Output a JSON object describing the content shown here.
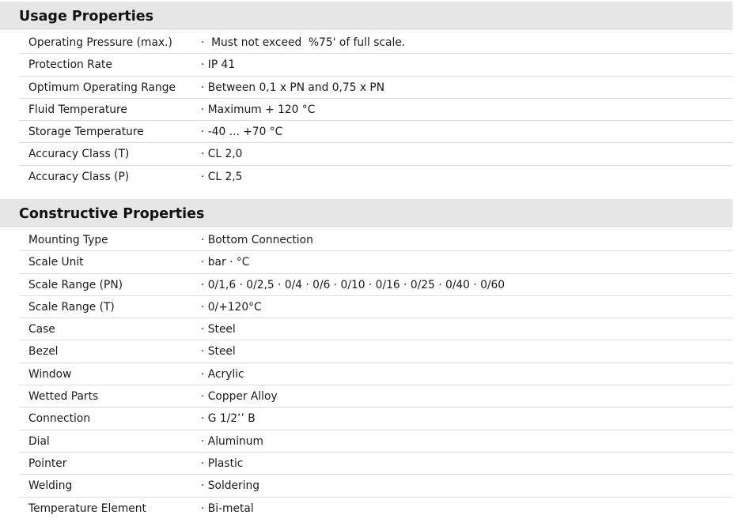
{
  "usage": {
    "title": "Usage Properties",
    "rows": [
      {
        "label": "Operating Pressure (max.)",
        "value": "·  Must not exceed  %75' of full scale."
      },
      {
        "label": "Protection Rate",
        "value": "· IP 41"
      },
      {
        "label": "Optimum Operating Range",
        "value": "· Between 0,1 x PN and 0,75 x PN"
      },
      {
        "label": "Fluid Temperature",
        "value": "· Maximum + 120 °C"
      },
      {
        "label": "Storage Temperature",
        "value": "· -40 ... +70 °C"
      },
      {
        "label": "Accuracy Class (T)",
        "value": "· CL 2,0"
      },
      {
        "label": "Accuracy Class (P)",
        "value": "· CL 2,5"
      }
    ]
  },
  "constructive": {
    "title": "Constructive Properties",
    "rows": [
      {
        "label": "Mounting Type",
        "value": "· Bottom Connection"
      },
      {
        "label": "Scale Unit",
        "value": "· bar · °C"
      },
      {
        "label": "Scale Range (PN)",
        "value": "· 0/1,6 · 0/2,5 · 0/4 · 0/6 · 0/10 · 0/16 · 0/25 · 0/40 · 0/60"
      },
      {
        "label": "Scale Range (T)",
        "value": "· 0/+120°C"
      },
      {
        "label": "Case",
        "value": "· Steel"
      },
      {
        "label": "Bezel",
        "value": "· Steel"
      },
      {
        "label": "Window",
        "value": "· Acrylic"
      },
      {
        "label": "Wetted Parts",
        "value": "· Copper Alloy"
      },
      {
        "label": "Connection",
        "value": "· G 1/2’’ B"
      },
      {
        "label": "Dial",
        "value": "· Aluminum"
      },
      {
        "label": "Pointer",
        "value": "· Plastic"
      },
      {
        "label": "Welding",
        "value": "· Soldering"
      },
      {
        "label": "Temperature Element",
        "value": "· Bi-metal"
      }
    ]
  }
}
